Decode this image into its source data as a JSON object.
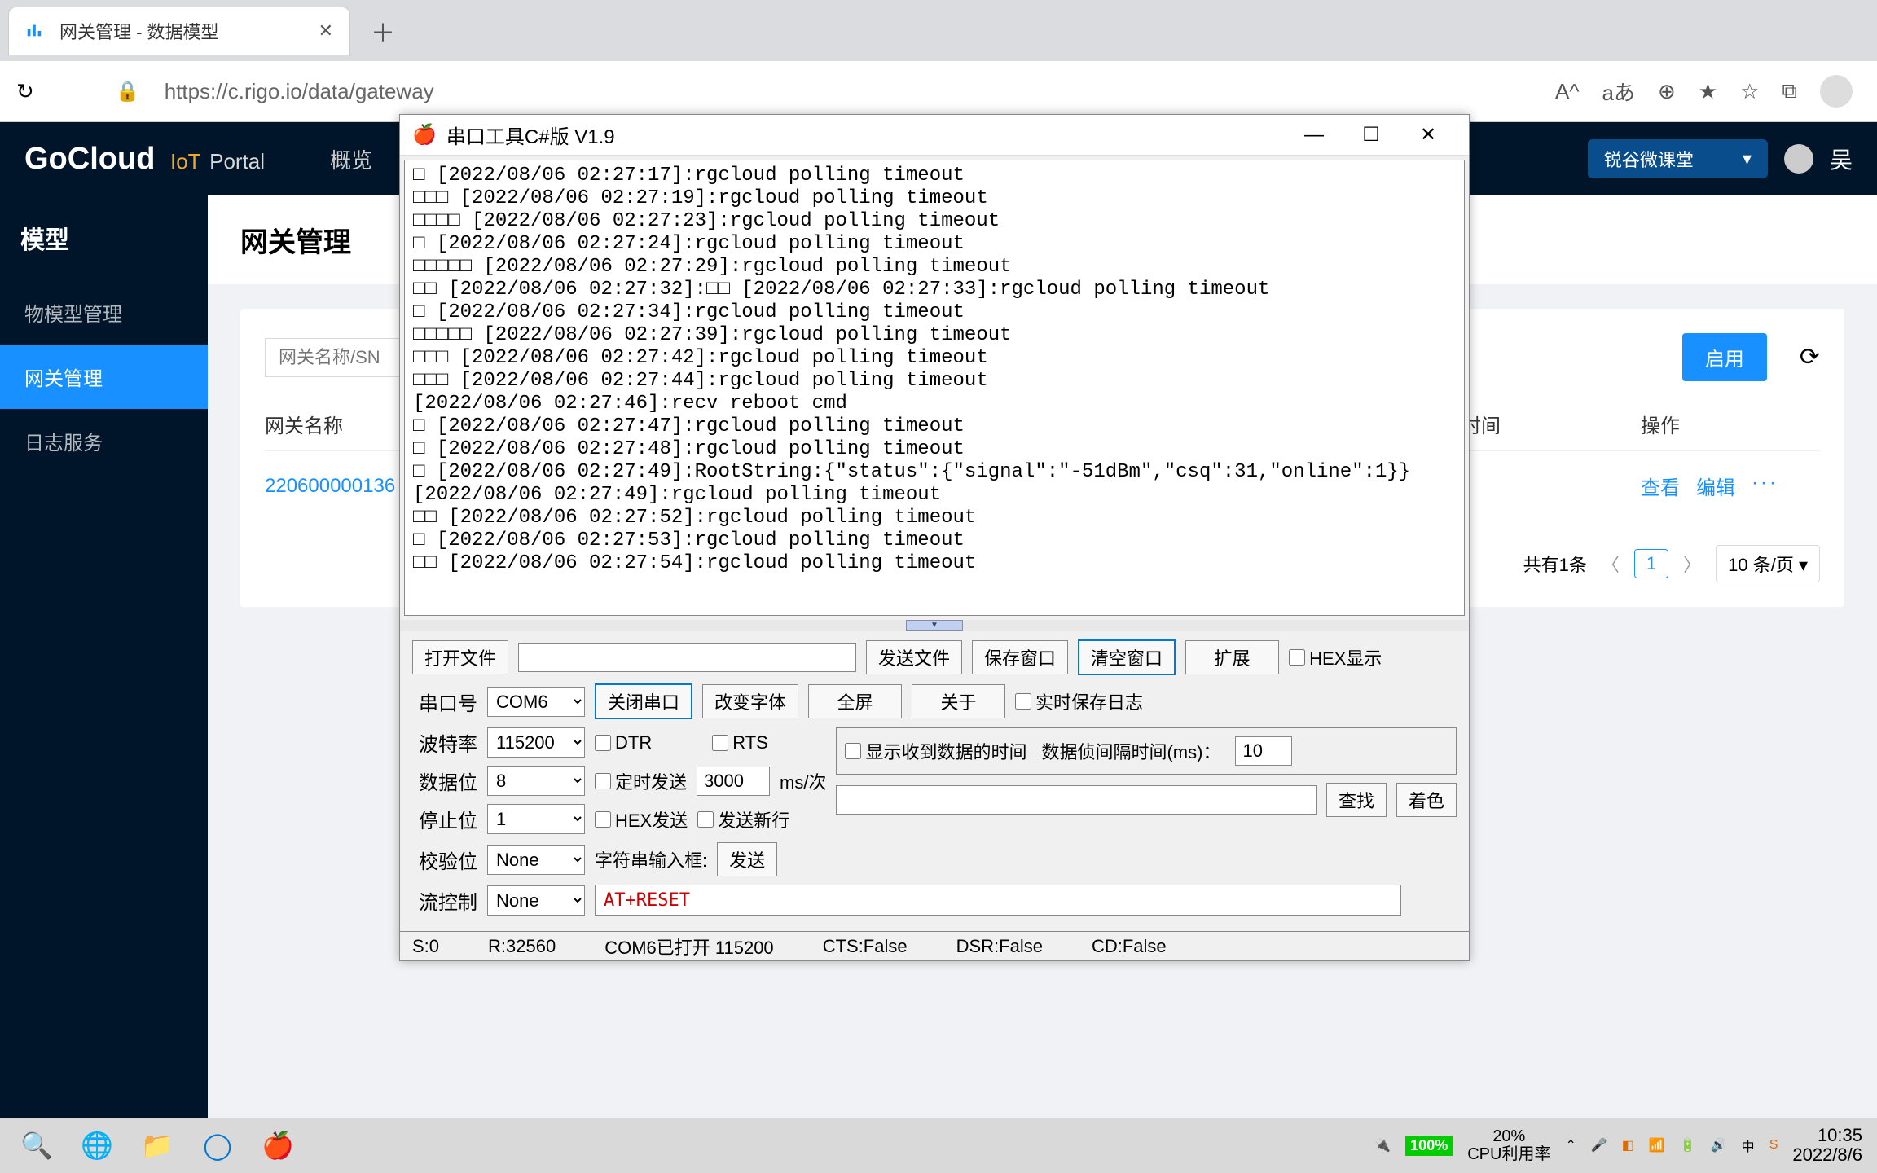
{
  "browser": {
    "tab_title": "网关管理 - 数据模型",
    "url": "https://c.rigo.io/data/gateway",
    "addr_icons": [
      "A^",
      "aあ",
      "⊕",
      "★",
      "☆",
      "⧉"
    ]
  },
  "portal": {
    "logo_main": "GoCloud",
    "logo_iot": "IoT",
    "logo_portal": "Portal",
    "menu_overview": "概览",
    "header_dropdown": "锐谷微课堂",
    "user_suffix": "吴",
    "sidebar_title": "模型",
    "sidebar_items": [
      "物模型管理",
      "网关管理",
      "日志服务"
    ],
    "page_title": "网关管理",
    "search_placeholder": "网关名称/SN",
    "btn_enable": "启用",
    "col_name": "网关名称",
    "col_time": "时间",
    "col_ops": "操作",
    "row_id": "220600000136",
    "op_view": "查看",
    "op_edit": "编辑",
    "op_more": "···",
    "pager_total": "共有1条",
    "pager_page": "1",
    "pager_size": "10 条/页"
  },
  "serial": {
    "title": "串口工具C#版  V1.9",
    "log": "□ [2022/08/06 02:27:17]:rgcloud polling timeout\n□□□ [2022/08/06 02:27:19]:rgcloud polling timeout\n□□□□ [2022/08/06 02:27:23]:rgcloud polling timeout\n□ [2022/08/06 02:27:24]:rgcloud polling timeout\n□□□□□ [2022/08/06 02:27:29]:rgcloud polling timeout\n□□ [2022/08/06 02:27:32]:□□ [2022/08/06 02:27:33]:rgcloud polling timeout\n□ [2022/08/06 02:27:34]:rgcloud polling timeout\n□□□□□ [2022/08/06 02:27:39]:rgcloud polling timeout\n□□□ [2022/08/06 02:27:42]:rgcloud polling timeout\n□□□ [2022/08/06 02:27:44]:rgcloud polling timeout\n[2022/08/06 02:27:46]:recv reboot cmd\n□ [2022/08/06 02:27:47]:rgcloud polling timeout\n□ [2022/08/06 02:27:48]:rgcloud polling timeout\n□ [2022/08/06 02:27:49]:RootString:{\"status\":{\"signal\":\"-51dBm\",\"csq\":31,\"online\":1}}\n[2022/08/06 02:27:49]:rgcloud polling timeout\n□□ [2022/08/06 02:27:52]:rgcloud polling timeout\n□ [2022/08/06 02:27:53]:rgcloud polling timeout\n□□ [2022/08/06 02:27:54]:rgcloud polling timeout",
    "btn_open_file": "打开文件",
    "btn_send_file": "发送文件",
    "btn_save_win": "保存窗口",
    "btn_clear_win": "清空窗口",
    "btn_extend": "扩展",
    "cb_hex_display": "HEX显示",
    "lbl_port": "串口号",
    "val_port": "COM6",
    "btn_close_port": "关闭串口",
    "btn_change_font": "改变字体",
    "btn_fullscreen": "全屏",
    "btn_about": "关于",
    "cb_realtime_save": "实时保存日志",
    "lbl_baud": "波特率",
    "val_baud": "115200",
    "cb_dtr": "DTR",
    "cb_rts": "RTS",
    "lbl_databits": "数据位",
    "val_databits": "8",
    "cb_timed_send": "定时发送",
    "val_timed_ms": "3000",
    "lbl_ms_per": "ms/次",
    "cb_show_recv_time": "显示收到数据的时间",
    "lbl_interval": "数据侦间隔时间(ms)：",
    "val_interval": "10",
    "lbl_stopbits": "停止位",
    "val_stopbits": "1",
    "cb_hex_send": "HEX发送",
    "cb_send_newline": "发送新行",
    "btn_find": "查找",
    "btn_color": "着色",
    "lbl_parity": "校验位",
    "val_parity": "None",
    "lbl_str_input": "字符串输入框:",
    "btn_send": "发送",
    "lbl_flow": "流控制",
    "val_flow": "None",
    "cmd_input": "AT+RESET",
    "status_s": "S:0",
    "status_r": "R:32560",
    "status_port": "COM6已打开   115200",
    "status_cts": "CTS:False",
    "status_dsr": "DSR:False",
    "status_cd": "CD:False"
  },
  "taskbar": {
    "battery": "100%",
    "cpu_pct": "20%",
    "cpu_label": "CPU利用率",
    "time": "10:35",
    "date": "2022/8/6"
  }
}
